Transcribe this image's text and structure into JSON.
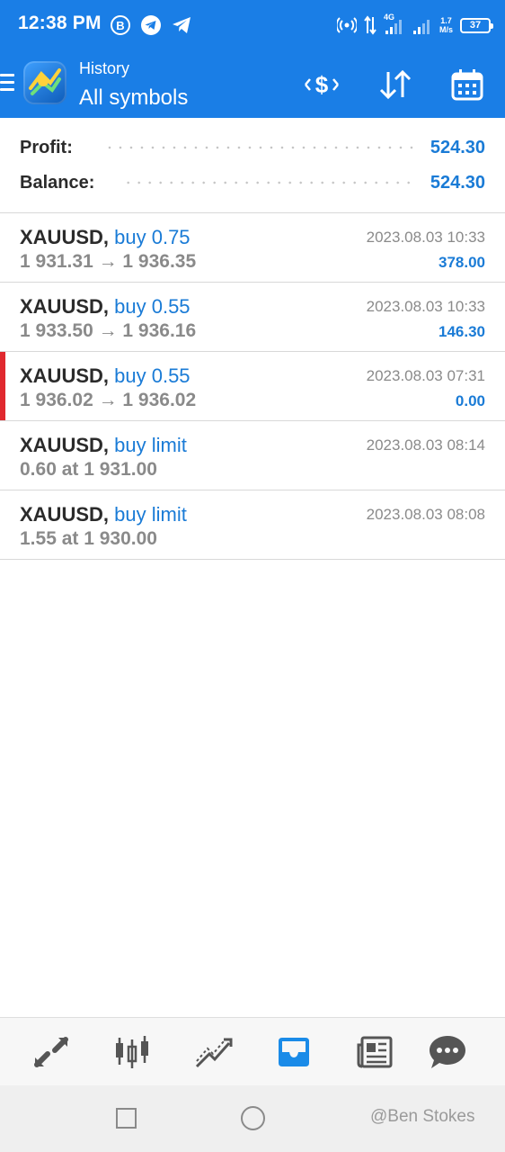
{
  "status_bar": {
    "time": "12:38 PM",
    "network": "4G",
    "speed_value": "1.7",
    "speed_unit": "M/s",
    "battery": "37"
  },
  "header": {
    "subtitle": "History",
    "title": "All symbols",
    "accent_color": "#1a7ee6"
  },
  "summary": {
    "profit_label": "Profit:",
    "profit_value": "524.30",
    "balance_label": "Balance:",
    "balance_value": "524.30"
  },
  "deals": [
    {
      "symbol": "XAUUSD,",
      "type": "buy 0.75",
      "prices": "1 931.31 → 1 936.35",
      "date": "2023.08.03 10:33",
      "profit": "378.00",
      "marked": false
    },
    {
      "symbol": "XAUUSD,",
      "type": "buy 0.55",
      "prices": "1 933.50 → 1 936.16",
      "date": "2023.08.03 10:33",
      "profit": "146.30",
      "marked": false
    },
    {
      "symbol": "XAUUSD,",
      "type": "buy 0.55",
      "prices": "1 936.02 → 1 936.02",
      "date": "2023.08.03 07:31",
      "profit": "0.00",
      "marked": true
    },
    {
      "symbol": "XAUUSD,",
      "type": "buy limit",
      "prices": "0.60 at 1 931.00",
      "date": "2023.08.03 08:14",
      "profit": "",
      "marked": false
    },
    {
      "symbol": "XAUUSD,",
      "type": "buy limit",
      "prices": "1.55 at 1 930.00",
      "date": "2023.08.03 08:08",
      "profit": "",
      "marked": false
    }
  ],
  "tabs": [
    {
      "name": "quotes",
      "icon": "quotes-arrows-icon",
      "active": false
    },
    {
      "name": "chart",
      "icon": "candlestick-icon",
      "active": false
    },
    {
      "name": "trade",
      "icon": "trade-line-icon",
      "active": false
    },
    {
      "name": "history",
      "icon": "inbox-icon",
      "active": true
    },
    {
      "name": "news",
      "icon": "newspaper-icon",
      "active": false
    },
    {
      "name": "messages",
      "icon": "chat-bubble-icon",
      "active": false
    }
  ],
  "watermark": "@Ben Stokes"
}
